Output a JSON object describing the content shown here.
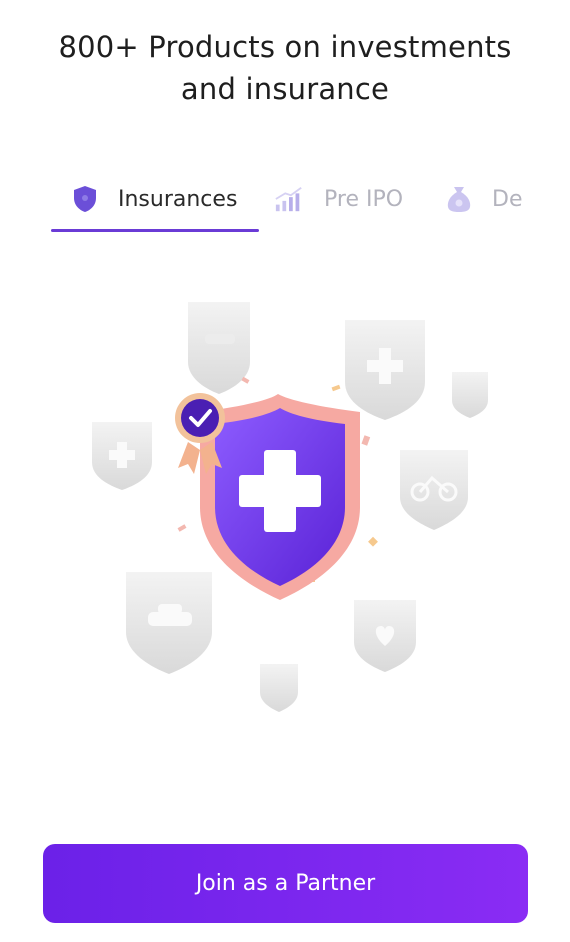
{
  "header": {
    "title_line1": "800+ Products on investments",
    "title_line2": "and insurance"
  },
  "tabs": [
    {
      "label": "Insurances",
      "icon": "shield-icon",
      "active": true
    },
    {
      "label": "Pre IPO",
      "icon": "bar-chart-icon",
      "active": false
    },
    {
      "label": "De",
      "icon": "money-bag-icon",
      "active": false
    }
  ],
  "illustration": {
    "icon": "insurance-shield-illustration"
  },
  "cta": {
    "label": "Join as a Partner"
  },
  "colors": {
    "accent": "#6a3bd6",
    "button": "#7b26ee",
    "inactive_text": "#b3b3bd"
  }
}
